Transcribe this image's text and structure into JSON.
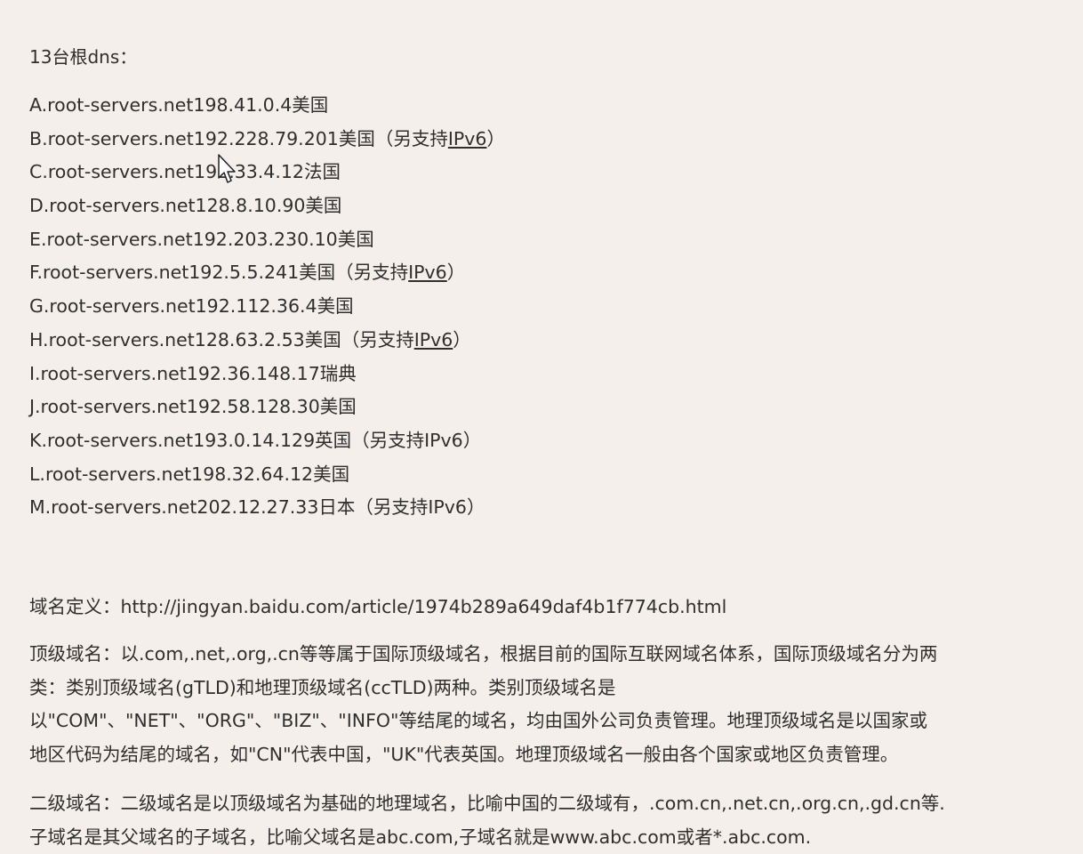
{
  "heading": "13台根dns：",
  "servers": [
    {
      "text": "A.root-servers.net198.41.0.4美国",
      "suffix_pre": "",
      "link": "",
      "suffix_post": ""
    },
    {
      "text": "B.root-servers.net192.228.79.201美国",
      "suffix_pre": "（另支持",
      "link": "IPv6",
      "suffix_post": "）"
    },
    {
      "text": "C.root-servers.net192.33.4.12法国",
      "suffix_pre": "",
      "link": "",
      "suffix_post": ""
    },
    {
      "text": "D.root-servers.net128.8.10.90美国",
      "suffix_pre": "",
      "link": "",
      "suffix_post": ""
    },
    {
      "text": "E.root-servers.net192.203.230.10美国",
      "suffix_pre": "",
      "link": "",
      "suffix_post": ""
    },
    {
      "text": "F.root-servers.net192.5.5.241美国",
      "suffix_pre": "（另支持",
      "link": "IPv6",
      "suffix_post": "）"
    },
    {
      "text": "G.root-servers.net192.112.36.4美国",
      "suffix_pre": "",
      "link": "",
      "suffix_post": ""
    },
    {
      "text": "H.root-servers.net128.63.2.53美国",
      "suffix_pre": "（另支持",
      "link": "IPv6",
      "suffix_post": "）"
    },
    {
      "text": "I.root-servers.net192.36.148.17瑞典",
      "suffix_pre": "",
      "link": "",
      "suffix_post": ""
    },
    {
      "text": "J.root-servers.net192.58.128.30美国",
      "suffix_pre": "",
      "link": "",
      "suffix_post": ""
    },
    {
      "text": "K.root-servers.net193.0.14.129英国（另支持IPv6）",
      "suffix_pre": "",
      "link": "",
      "suffix_post": ""
    },
    {
      "text": "L.root-servers.net198.32.64.12美国",
      "suffix_pre": "",
      "link": "",
      "suffix_post": ""
    },
    {
      "text": "M.root-servers.net202.12.27.33日本（另支持IPv6）",
      "suffix_pre": "",
      "link": "",
      "suffix_post": ""
    }
  ],
  "domain_definition": {
    "label": "域名定义：",
    "url": "http://jingyan.baidu.com/article/1974b289a649daf4b1f774cb.html"
  },
  "tld_paragraph": {
    "lines": [
      "顶级域名：以.com,.net,.org,.cn等等属于国际顶级域名，根据目前的国际互联网域名体系，国际顶级域名分为两",
      "类：类别顶级域名(gTLD)和地理顶级域名(ccTLD)两种。类别顶级域名是",
      " 以\"COM\"、\"NET\"、\"ORG\"、\"BIZ\"、\"INFO\"等结尾的域名，均由国外公司负责管理。地理顶级域名是以国家或",
      "地区代码为结尾的域名，如\"CN\"代表中国，\"UK\"代表英国。地理顶级域名一般由各个国家或地区负责管理。"
    ]
  },
  "sld_paragraph": {
    "lines": [
      "二级域名：二级域名是以顶级域名为基础的地理域名，比喻中国的二级域有，.com.cn,.net.cn,.org.cn,.gd.cn等.",
      "子域名是其父域名的子域名，比喻父域名是abc.com,子域名就是www.abc.com或者*.abc.com."
    ]
  }
}
